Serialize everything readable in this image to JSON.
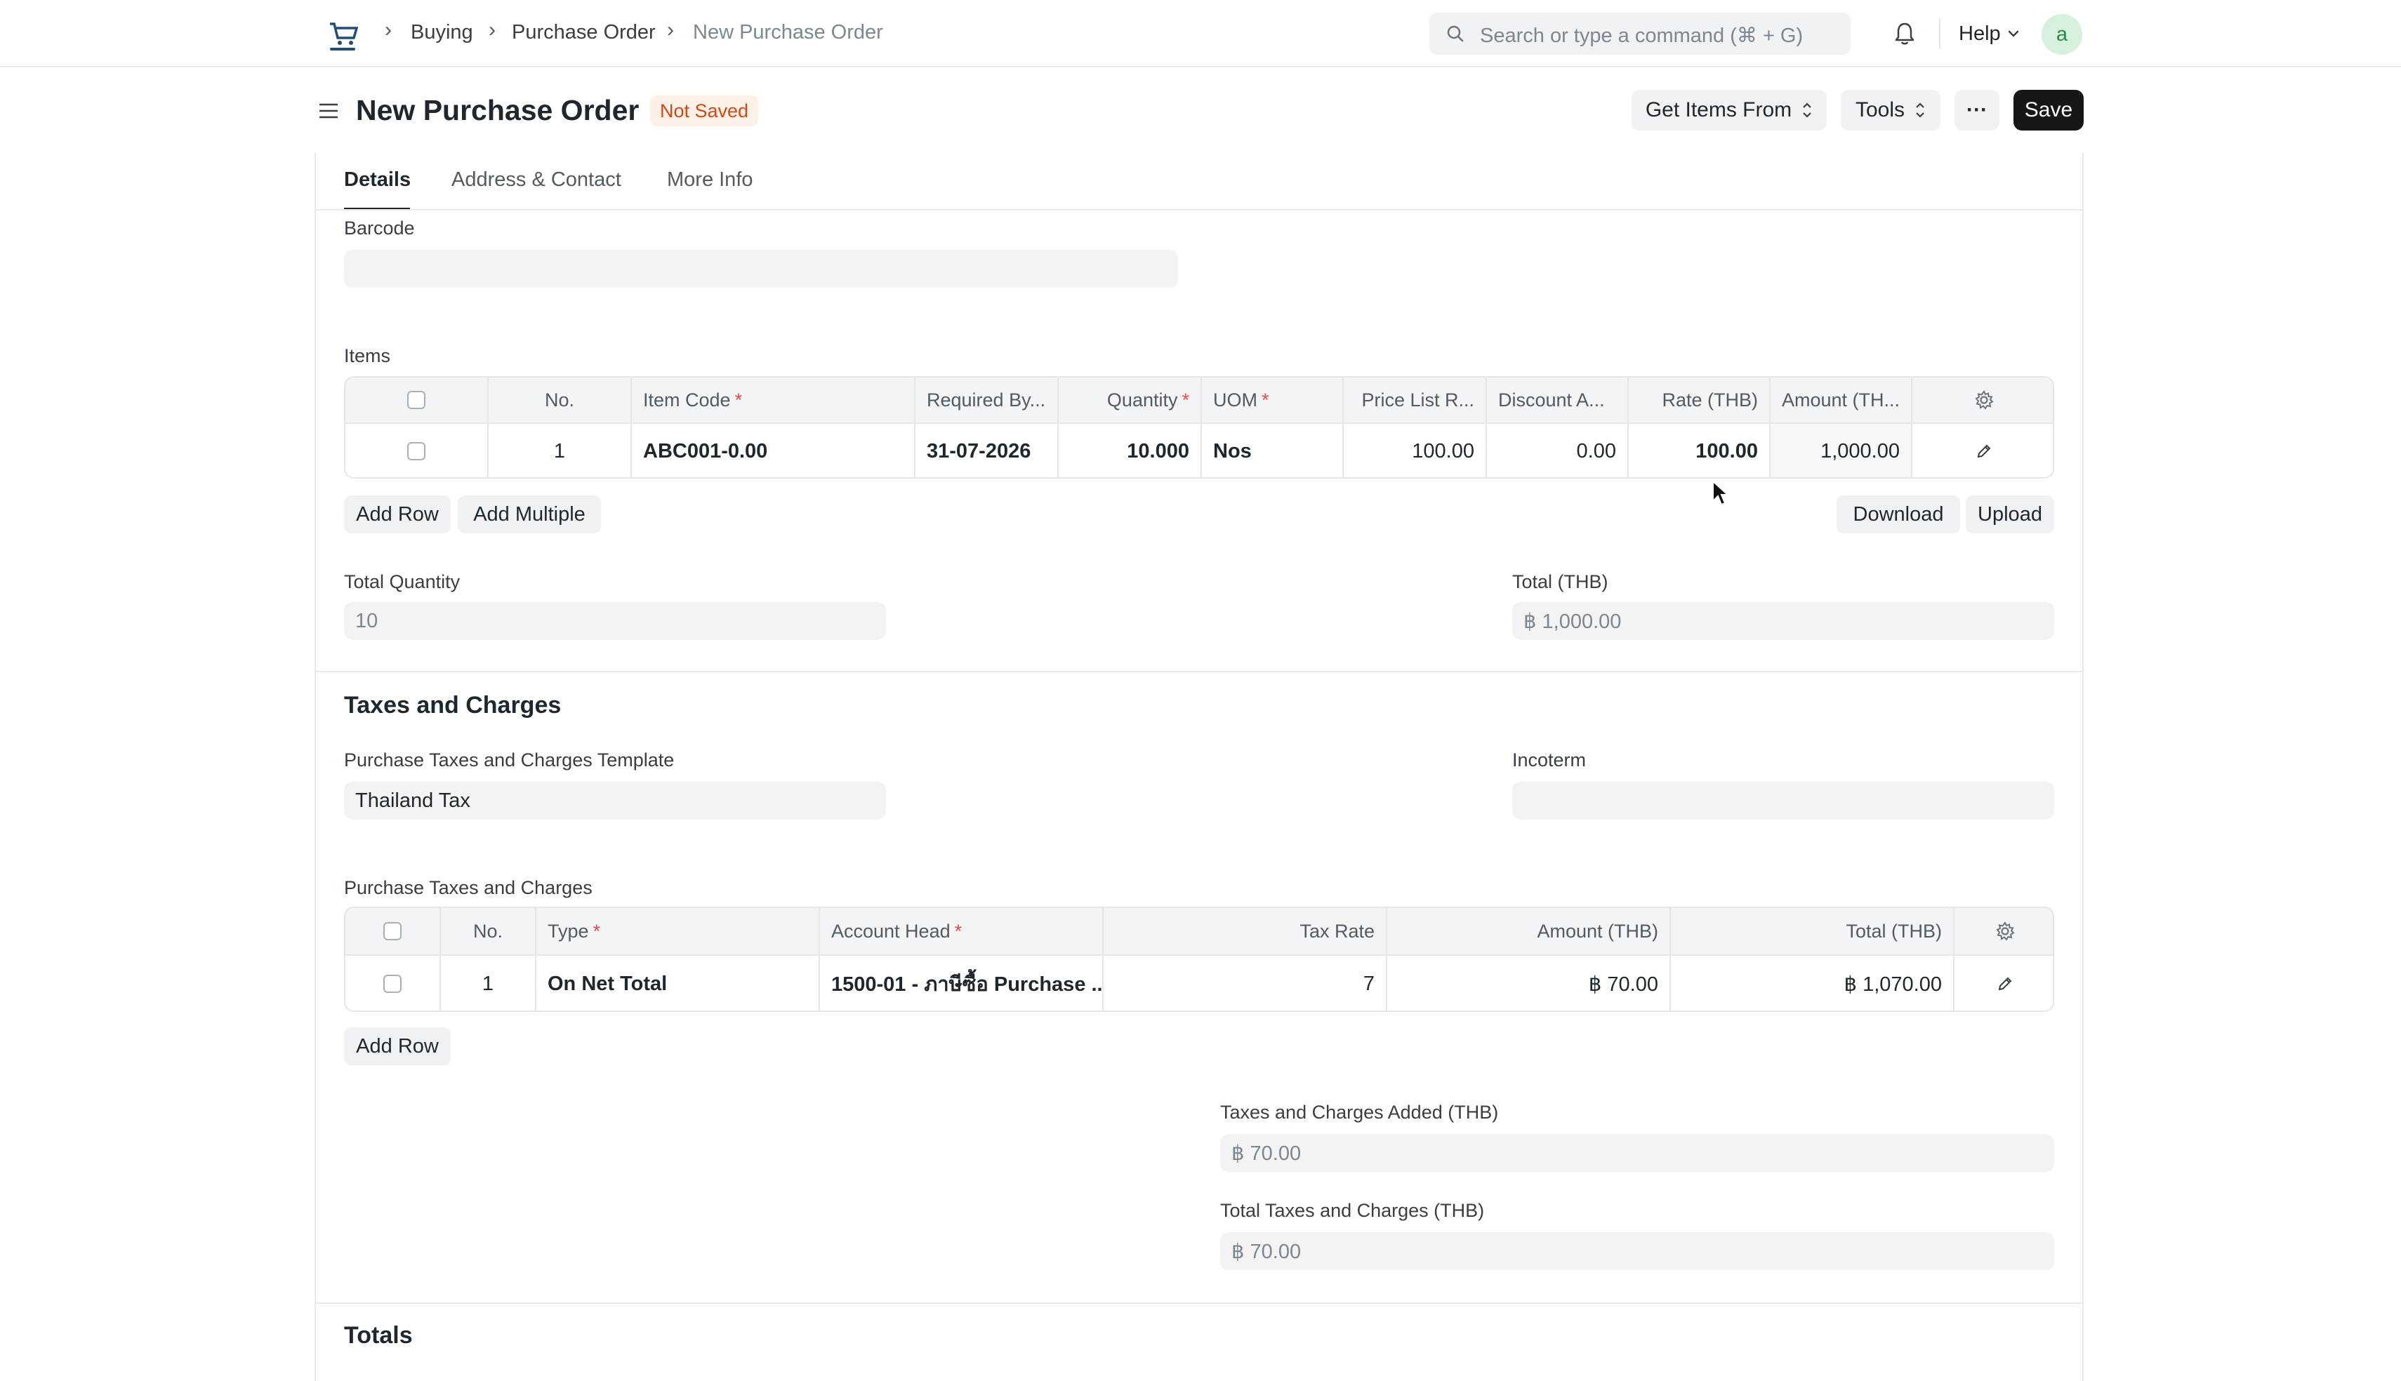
{
  "breadcrumbs": [
    "Buying",
    "Purchase Order",
    "New Purchase Order"
  ],
  "search": {
    "placeholder": "Search or type a command (⌘ + G)"
  },
  "nav": {
    "help_label": "Help",
    "avatar_letter": "a"
  },
  "header": {
    "title": "New Purchase Order",
    "status": "Not Saved",
    "get_items_label": "Get Items From",
    "tools_label": "Tools",
    "more_label": "···",
    "save_label": "Save"
  },
  "tabs": [
    {
      "label": "Details",
      "active": true
    },
    {
      "label": "Address & Contact",
      "active": false
    },
    {
      "label": "More Info",
      "active": false
    }
  ],
  "barcode": {
    "label": "Barcode",
    "value": ""
  },
  "items": {
    "label": "Items",
    "columns": [
      "No.",
      "Item Code",
      "Required By...",
      "Quantity",
      "UOM",
      "Price List R...",
      "Discount A...",
      "Rate (THB)",
      "Amount (TH..."
    ],
    "rows": [
      {
        "no": "1",
        "item_code": "ABC001-0.00",
        "required_by": "31-07-2026",
        "quantity": "10.000",
        "uom": "Nos",
        "price_list_rate": "100.00",
        "discount": "0.00",
        "rate": "100.00",
        "amount": "1,000.00"
      }
    ],
    "add_row_label": "Add Row",
    "add_multiple_label": "Add Multiple",
    "download_label": "Download",
    "upload_label": "Upload"
  },
  "total_quantity": {
    "label": "Total Quantity",
    "value": "10"
  },
  "total_thb": {
    "label": "Total (THB)",
    "value": "฿ 1,000.00"
  },
  "taxes_section": {
    "title": "Taxes and Charges",
    "template_label": "Purchase Taxes and Charges Template",
    "template_value": "Thailand Tax",
    "incoterm_label": "Incoterm",
    "incoterm_value": "",
    "table_label": "Purchase Taxes and Charges",
    "columns": [
      "No.",
      "Type",
      "Account Head",
      "Tax Rate",
      "Amount (THB)",
      "Total (THB)"
    ],
    "rows": [
      {
        "no": "1",
        "type": "On Net Total",
        "account_head": "1500-01 - ภาษีซื้อ Purchase ...",
        "tax_rate": "7",
        "amount": "฿ 70.00",
        "total": "฿ 1,070.00"
      }
    ],
    "add_row_label": "Add Row",
    "taxes_added_label": "Taxes and Charges Added (THB)",
    "taxes_added_value": "฿ 70.00",
    "total_taxes_label": "Total Taxes and Charges (THB)",
    "total_taxes_value": "฿ 70.00"
  },
  "totals_section": {
    "title": "Totals"
  },
  "colors": {
    "accent": "#171717",
    "status_text": "#cb4b16",
    "status_bg": "#fdf0e6",
    "avatar_bg": "#d6f0dc",
    "avatar_text": "#2a8a4a"
  }
}
